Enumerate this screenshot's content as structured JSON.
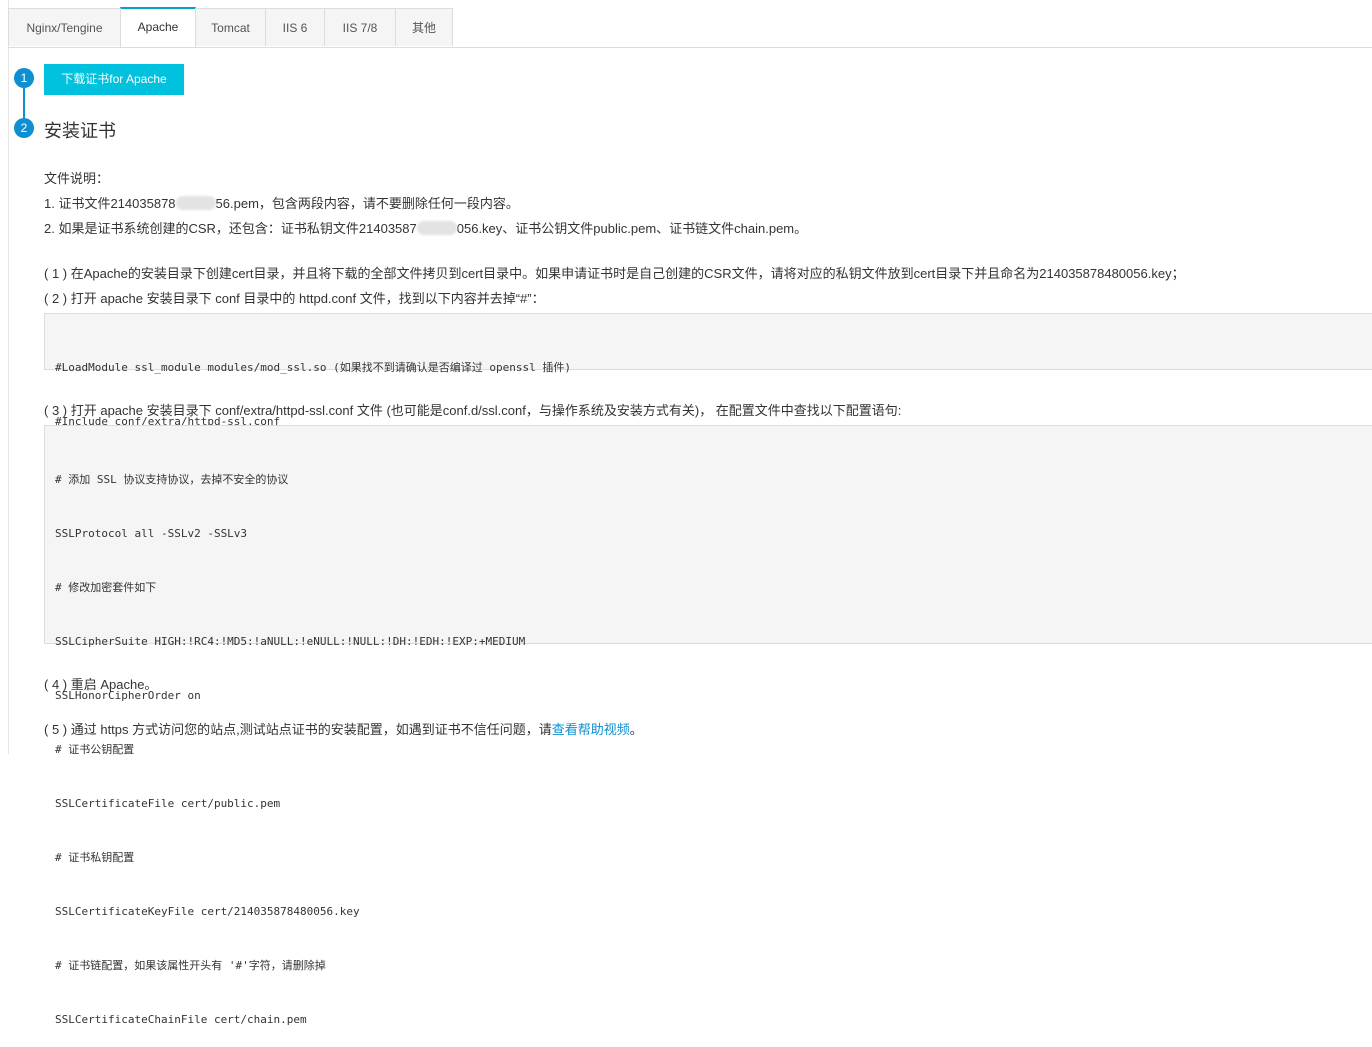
{
  "tabs": [
    "Nginx/Tengine",
    "Apache",
    "Tomcat",
    "IIS 6",
    "IIS 7/8",
    "其他"
  ],
  "active_tab": "Apache",
  "steps": {
    "step1_number": "1",
    "download_button": "下载证书for Apache",
    "step2_number": "2",
    "step2_title": "安装证书"
  },
  "file_notes": {
    "heading": "文件说明：",
    "line1_prefix": "1. 证书文件214035878",
    "line1_suffix": "56.pem，包含两段内容，请不要删除任何一段内容。",
    "line2_prefix": "2. 如果是证书系统创建的CSR，还包含：证书私钥文件21403587",
    "line2_suffix": "056.key、证书公钥文件public.pem、证书链文件chain.pem。"
  },
  "instructions": {
    "step1": "( 1 ) 在Apache的安装目录下创建cert目录，并且将下载的全部文件拷贝到cert目录中。如果申请证书时是自己创建的CSR文件，请将对应的私钥文件放到cert目录下并且命名为214035878480056.key；",
    "step2": "( 2 ) 打开 apache 安装目录下 conf 目录中的 httpd.conf 文件，找到以下内容并去掉“#”：",
    "step3": "( 3 ) 打开 apache 安装目录下 conf/extra/httpd-ssl.conf 文件 (也可能是conf.d/ssl.conf，与操作系统及安装方式有关)， 在配置文件中查找以下配置语句:",
    "step4": "( 4 ) 重启 Apache。",
    "step5_prefix": "( 5 ) 通过 https 方式访问您的站点,测试站点证书的安装配置，如遇到证书不信任问题，请",
    "step5_link": "查看帮助视频",
    "step5_suffix": "。"
  },
  "code_block_1": [
    "#LoadModule ssl_module modules/mod_ssl.so (如果找不到请确认是否编译过 openssl 插件)",
    "#Include conf/extra/httpd-ssl.conf"
  ],
  "code_block_2": [
    "# 添加 SSL 协议支持协议，去掉不安全的协议",
    "SSLProtocol all -SSLv2 -SSLv3",
    "# 修改加密套件如下",
    "SSLCipherSuite HIGH:!RC4:!MD5:!aNULL:!eNULL:!NULL:!DH:!EDH:!EXP:+MEDIUM",
    "SSLHonorCipherOrder on",
    "# 证书公钥配置",
    "SSLCertificateFile cert/public.pem",
    "# 证书私钥配置",
    "SSLCertificateKeyFile cert/214035878480056.key",
    "# 证书链配置，如果该属性开头有 '#'字符，请删除掉",
    "SSLCertificateChainFile cert/chain.pem"
  ],
  "colors": {
    "accent": "#00c1de",
    "step": "#0e8fcf",
    "link": "#0e8fcf"
  }
}
